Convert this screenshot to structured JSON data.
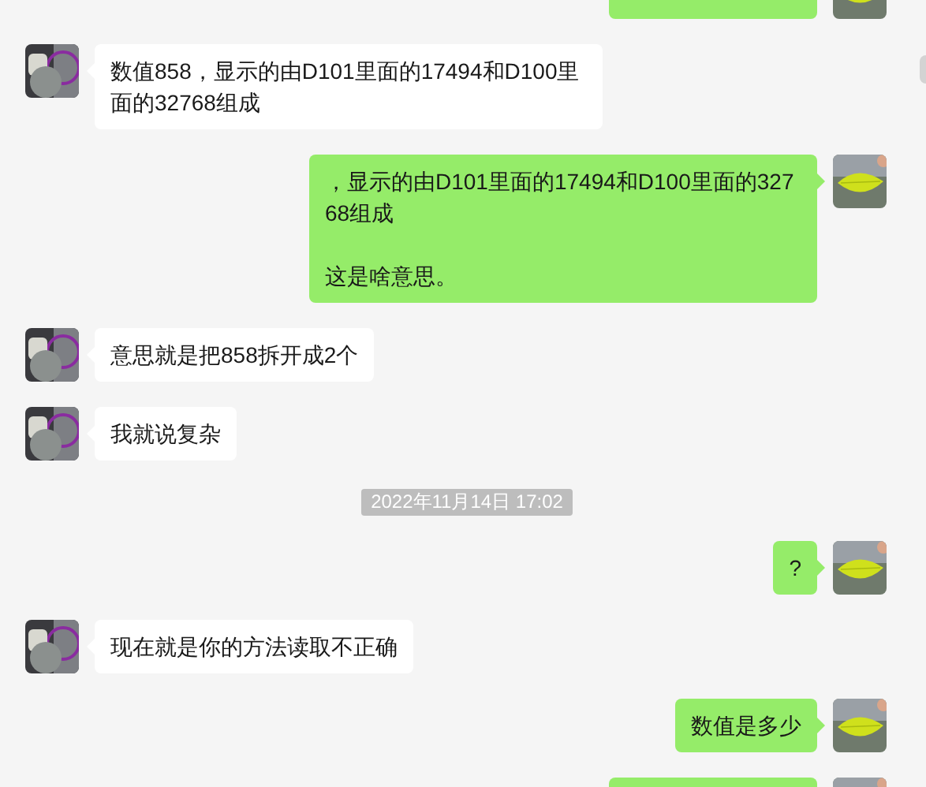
{
  "messages": [
    {
      "kind": "me"
    },
    {
      "kind": "them",
      "paragraphs": [
        "数值858，显示的由D101里面的17494和D100里面的32768组成"
      ]
    },
    {
      "kind": "me",
      "paragraphs": [
        "，显示的由D101里面的17494和D100里面的32768组成",
        "这是啥意思。"
      ]
    },
    {
      "kind": "them",
      "paragraphs": [
        "意思就是把858拆开成2个"
      ]
    },
    {
      "kind": "them",
      "paragraphs": [
        "我就说复杂"
      ]
    },
    {
      "kind": "time",
      "text": "2022年11月14日 17:02"
    },
    {
      "kind": "me",
      "paragraphs": [
        "?"
      ]
    },
    {
      "kind": "them",
      "paragraphs": [
        "现在就是你的方法读取不正确"
      ]
    },
    {
      "kind": "me",
      "paragraphs": [
        "数值是多少"
      ]
    },
    {
      "kind": "me"
    }
  ]
}
